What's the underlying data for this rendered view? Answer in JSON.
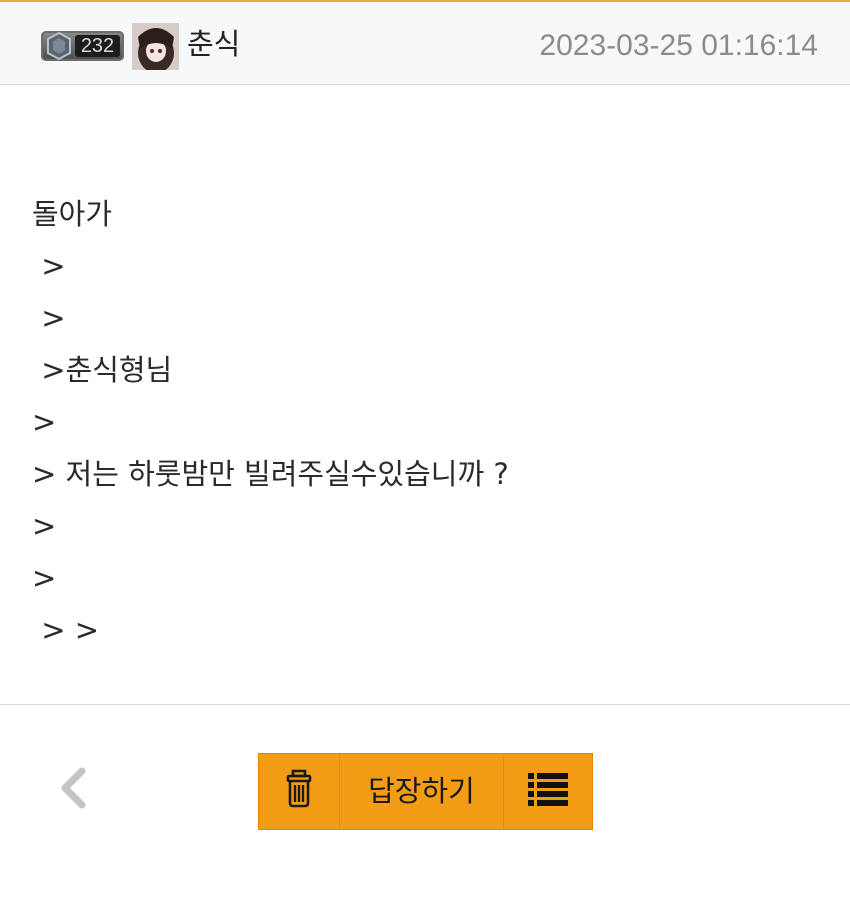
{
  "header": {
    "level": "232",
    "username": "춘식",
    "date": "2023-03-25 01:16:14"
  },
  "content": {
    "lines": [
      "돌아가",
      " >",
      " >",
      " >춘식형님",
      ">",
      "> 저는 하룻밤만 빌려주실수있습니까 ?",
      ">",
      ">",
      " > >"
    ]
  },
  "actions": {
    "back_icon": "chevron-left-icon",
    "delete_icon": "trash-icon",
    "reply_label": "답장하기",
    "list_icon": "list-icon"
  },
  "colors": {
    "accent": "#f39d17",
    "header_bg": "#f7f8f9",
    "date_text": "#8b8b8b"
  }
}
